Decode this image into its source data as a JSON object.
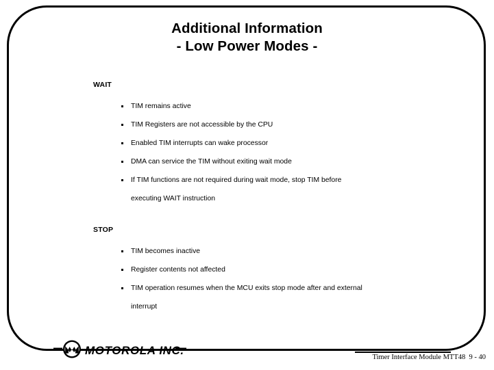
{
  "slide": {
    "title_line_1": "Additional Information",
    "title_line_2": "- Low Power Modes -",
    "frame_color": "#000000",
    "background_color": "#ffffff",
    "text_color": "#000000"
  },
  "sections": [
    {
      "heading": "WAIT",
      "bullets": [
        {
          "text": "TIM remains active",
          "continuation": ""
        },
        {
          "text": "TIM Registers are not accessible by the CPU",
          "continuation": ""
        },
        {
          "text": "Enabled TIM interrupts can wake processor",
          "continuation": ""
        },
        {
          "text": "DMA can service the TIM without exiting wait mode",
          "continuation": ""
        },
        {
          "text": "If TIM functions are not required during wait mode, stop TIM before",
          "continuation": "executing WAIT instruction"
        }
      ]
    },
    {
      "heading": "STOP",
      "bullets": [
        {
          "text": "TIM becomes inactive",
          "continuation": ""
        },
        {
          "text": "Register contents not affected",
          "continuation": ""
        },
        {
          "text": "TIM operation resumes when the MCU exits stop mode after and external",
          "continuation": "interrupt"
        }
      ]
    }
  ],
  "logo": {
    "wordmark": "MOTOROLA INC.",
    "symbol": "motorola-batwing-m"
  },
  "footer": {
    "text": "Timer Interface Module MTT48  9 - 40"
  }
}
